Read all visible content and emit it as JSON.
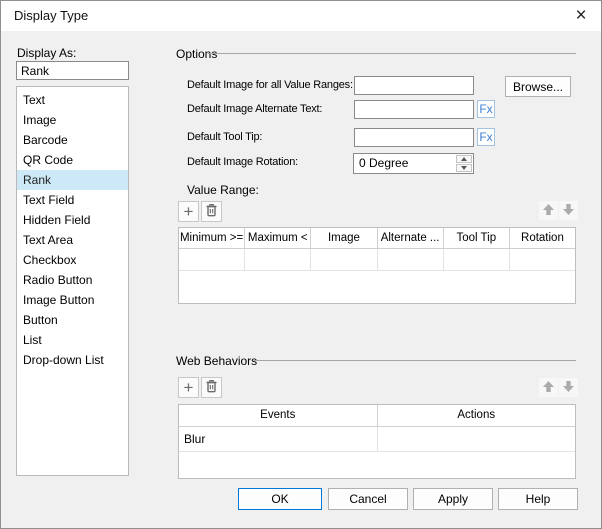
{
  "window": {
    "title": "Display Type",
    "icons": {
      "close": "×",
      "add": "+",
      "delete": "trash-can",
      "move_up": "thick-up-arrow",
      "move_down": "thick-down-arrow"
    }
  },
  "display_as": {
    "label": "Display As:",
    "value": "Rank",
    "selected_index": 4,
    "options": [
      "Text",
      "Image",
      "Barcode",
      "QR Code",
      "Rank",
      "Text Field",
      "Hidden Field",
      "Text Area",
      "Checkbox",
      "Radio Button",
      "Image Button",
      "Button",
      "List",
      "Drop-down List"
    ]
  },
  "options_section": {
    "title": "Options",
    "default_image_label": "Default Image for all Value Ranges:",
    "default_image_value": "",
    "browse_button": "Browse...",
    "alternate_text_label": "Default Image Alternate Text:",
    "alternate_text_value": "",
    "fx_button": "Fx",
    "tooltip_label": "Default Tool Tip:",
    "tooltip_value": "",
    "rotation_label": "Default Image Rotation:",
    "rotation_value": "0 Degree",
    "value_range_label": "Value Range:",
    "value_range_table": {
      "columns": [
        "Minimum >=",
        "Maximum <",
        "Image",
        "Alternate ...",
        "Tool Tip",
        "Rotation"
      ],
      "rows": [
        [
          "",
          "",
          "",
          "",
          "",
          ""
        ]
      ]
    }
  },
  "web_behaviors": {
    "title": "Web Behaviors",
    "table": {
      "columns": [
        "Events",
        "Actions"
      ],
      "rows": [
        [
          "Blur",
          ""
        ]
      ]
    }
  },
  "footer": {
    "ok": "OK",
    "cancel": "Cancel",
    "apply": "Apply",
    "help": "Help"
  },
  "colors": {
    "accent": "#0078d7",
    "selection_bg": "#cde8f6",
    "fx_blue": "#3f7fd6",
    "titlebar_bg": "#ffffff",
    "body_bg": "#f0f0f0"
  }
}
